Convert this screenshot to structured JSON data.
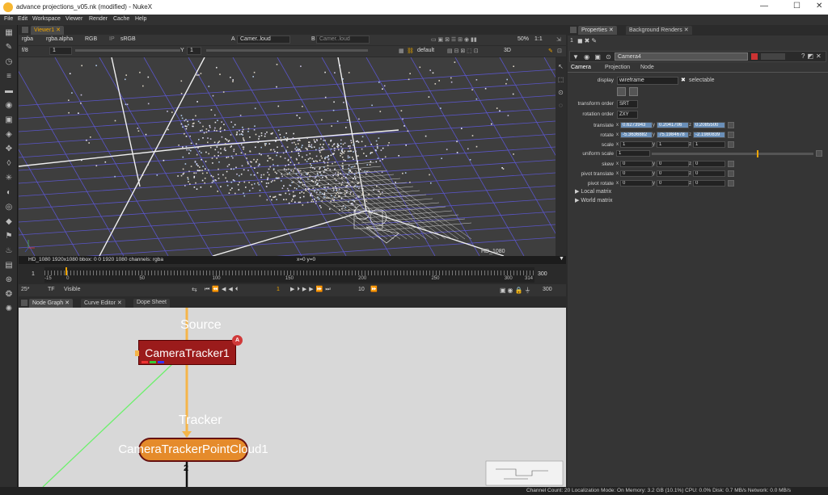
{
  "window": {
    "title": "advance projections_v05.nk (modified) - NukeX",
    "controls": [
      "—",
      "☐",
      "✕"
    ]
  },
  "menu": [
    "File",
    "Edit",
    "Workspace",
    "Viewer",
    "Render",
    "Cache",
    "Help"
  ],
  "viewer": {
    "tab": "Viewer1",
    "channels": "rgba",
    "alpha": "rgba.alpha",
    "colorspace_mode": "RGB",
    "ip_label": "IP",
    "lut": "sRGB",
    "a_label": "A",
    "a_input": "Camer..loud",
    "b_label": "B",
    "b_input": "Camer..loud",
    "zoom": "50%",
    "ratio": "1:1",
    "fstop": "f/8",
    "frame_field": "1",
    "y_label": "Y",
    "y_value": "1",
    "cam_view": "default",
    "view_mode": "3D",
    "format_right": "HD_1080",
    "info": "HD_1080 1920x1080  bbox: 0 0 1920 1080  channels: rgba",
    "coords": "x=0 y=0"
  },
  "timeline": {
    "start_field": "1",
    "end_field": "300",
    "ticks": [
      "-15",
      "0",
      "50",
      "100",
      "150",
      "200",
      "250",
      "300",
      "314"
    ],
    "fps": "25*",
    "tf": "TF",
    "visible": "Visible",
    "current_frame": "1",
    "step": "10",
    "end2": "300"
  },
  "node_graph": {
    "tabs": [
      "Node Graph",
      "Curve Editor",
      "Dope Sheet"
    ],
    "source_label": "Source",
    "tracker_label": "Tracker",
    "node1": "CameraTracker1",
    "node1_badge": "A",
    "node2": "CameraTrackerPointCloud1",
    "bottom_num": "2"
  },
  "properties": {
    "tabs": [
      "Properties",
      "Background Renders"
    ],
    "panel_count": "1",
    "node_name": "Camera4",
    "subtabs": [
      "Camera",
      "Projection",
      "Node"
    ],
    "display_label": "display",
    "display_value": "wireframe",
    "selectable_label": "selectable",
    "transform_order_label": "transform order",
    "transform_order": "SRT",
    "rotation_order_label": "rotation order",
    "rotation_order": "ZXY",
    "rows": [
      {
        "label": "translate",
        "x": "0.6273943",
        "y": "0.2041706",
        "z": "0.2085500",
        "selected": true
      },
      {
        "label": "rotate",
        "x": "-5.3636882",
        "y": "75.1984678",
        "z": "-2.1980839",
        "selected": true
      },
      {
        "label": "scale",
        "x": "1",
        "y": "1",
        "z": "1",
        "selected": false
      },
      {
        "label": "skew",
        "x": "0",
        "y": "0",
        "z": "0",
        "selected": false
      },
      {
        "label": "pivot translate",
        "x": "0",
        "y": "0",
        "z": "0",
        "selected": false
      },
      {
        "label": "pivot rotate",
        "x": "0",
        "y": "0",
        "z": "0",
        "selected": false
      }
    ],
    "uniform_scale_label": "uniform scale",
    "uniform_scale": "1",
    "local_matrix": "Local matrix",
    "world_matrix": "World matrix"
  },
  "status": "Channel Count: 20  Localization Mode: On  Memory: 3.2 GB (10.1%)  CPU: 0.0%  Disk: 0.7 MB/s  Network: 0.0 MB/s"
}
